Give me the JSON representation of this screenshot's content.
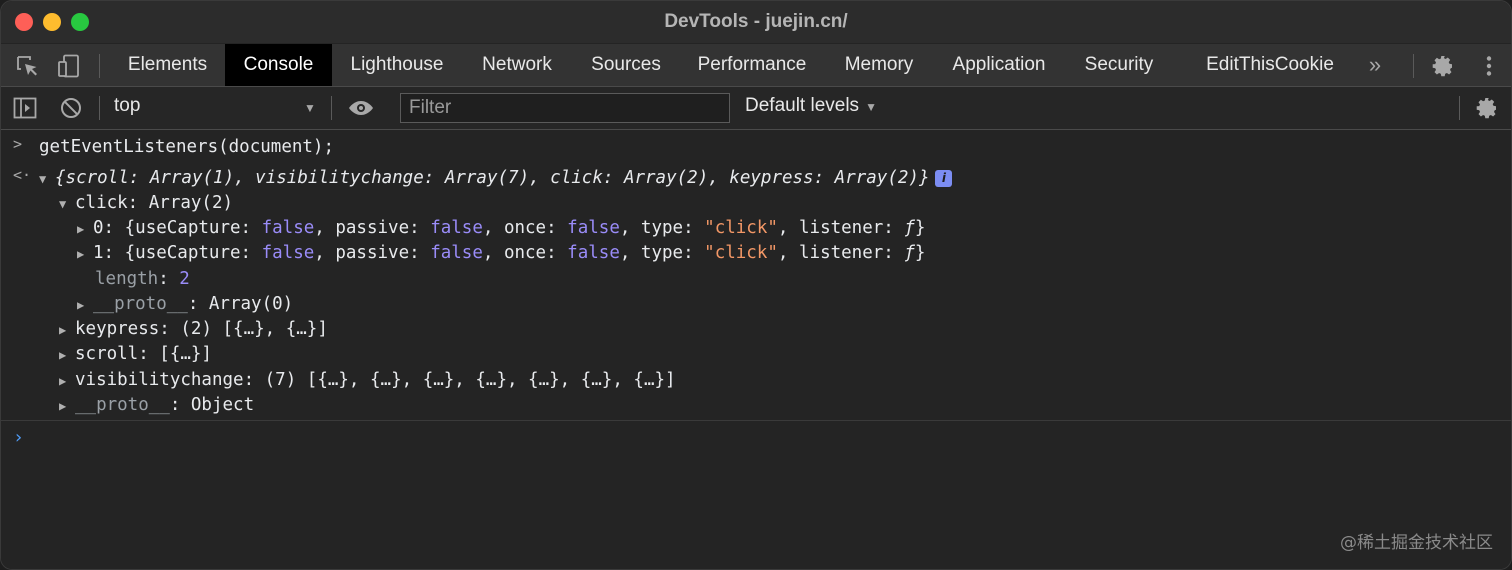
{
  "window": {
    "title": "DevTools - juejin.cn/"
  },
  "tabs": [
    "Elements",
    "Console",
    "Lighthouse",
    "Network",
    "Sources",
    "Performance",
    "Memory",
    "Application",
    "Security",
    "EditThisCookie"
  ],
  "active_tab": "Console",
  "more_tabs": "»",
  "toolbar": {
    "context": "top",
    "filter_placeholder": "Filter",
    "levels": "Default levels"
  },
  "console": {
    "input": "getEventListeners(document);",
    "summary": "{scroll: Array(1), visibilitychange: Array(7), click: Array(2), keypress: Array(2)}",
    "info": "i",
    "click_label": "click: Array(2)",
    "item0_index": "0",
    "item1_index": "1",
    "obj_open": ": {useCapture: ",
    "passive_key": ", passive: ",
    "once_key": ", once: ",
    "type_key": ", type: ",
    "listener_key": ", listener: ",
    "false_val": "false",
    "type_val": "\"click\"",
    "listener_val": "ƒ",
    "obj_close": "}",
    "length_key": "length",
    "length_val": "2",
    "proto_key": "__proto__",
    "proto_array": ": Array(0)",
    "keypress": "keypress",
    "keypress_val": ": (2) [{…}, {…}]",
    "scroll": "scroll",
    "scroll_val": ": [{…}]",
    "visibilitychange": "visibilitychange",
    "visibilitychange_val": ": (7) [{…}, {…}, {…}, {…}, {…}, {…}, {…}]",
    "proto_object": ": Object"
  },
  "watermark": "@稀土掘金技术社区"
}
